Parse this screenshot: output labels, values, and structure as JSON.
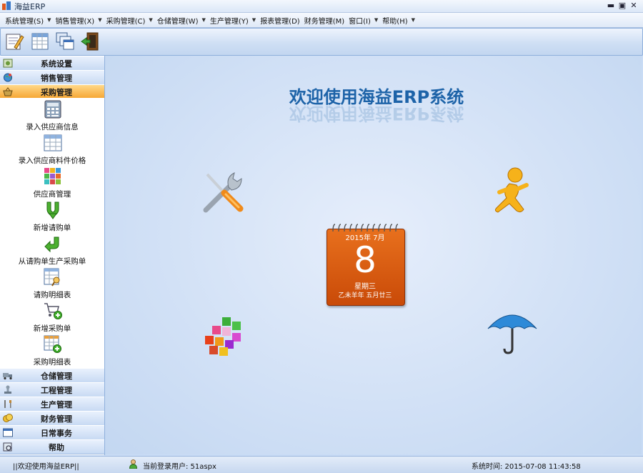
{
  "window": {
    "title": "海益ERP",
    "minimize": "▬",
    "restore": "▣",
    "close": "✕"
  },
  "menu": [
    {
      "label": "系统管理(S)"
    },
    {
      "label": "销售管理(X)"
    },
    {
      "label": "采购管理(C)"
    },
    {
      "label": "仓储管理(W)"
    },
    {
      "label": "生产管理(Y)"
    },
    {
      "label": "报表管理(D)"
    },
    {
      "label": "财务管理(M)"
    },
    {
      "label": "窗口(I)"
    },
    {
      "label": "帮助(H)"
    }
  ],
  "toolbar": {
    "buttons": [
      "notepad-edit-icon",
      "spreadsheet-icon",
      "windows-cascade-icon",
      "exit-door-icon"
    ]
  },
  "sidebar": {
    "top_groups": [
      {
        "label": "系统设置",
        "icon": "settings-icon"
      },
      {
        "label": "销售管理",
        "icon": "globe-icon"
      },
      {
        "label": "采购管理",
        "icon": "basket-icon",
        "active": true
      }
    ],
    "items": [
      {
        "label": "录入供应商信息",
        "icon": "calculator-icon"
      },
      {
        "label": "录入供应商料件价格",
        "icon": "price-grid-icon"
      },
      {
        "label": "供应商管理",
        "icon": "color-blocks-icon"
      },
      {
        "label": "新增请购单",
        "icon": "green-down-arrow-icon"
      },
      {
        "label": "从请购单生产采购单",
        "icon": "green-return-arrow-icon"
      },
      {
        "label": "请购明细表",
        "icon": "table-search-icon"
      },
      {
        "label": "新增采购单",
        "icon": "cart-add-icon"
      },
      {
        "label": "采购明细表",
        "icon": "table-add-icon"
      }
    ],
    "bottom_groups": [
      {
        "label": "仓储管理",
        "icon": "truck-icon"
      },
      {
        "label": "工程管理",
        "icon": "stamp-icon"
      },
      {
        "label": "生产管理",
        "icon": "tools-icon"
      },
      {
        "label": "财务管理",
        "icon": "coins-icon"
      },
      {
        "label": "日常事务",
        "icon": "window-icon"
      },
      {
        "label": "帮助",
        "icon": "help-book-icon"
      }
    ]
  },
  "main": {
    "welcome": "欢迎使用海益ERP系统",
    "calendar": {
      "year_month": "2015年  7月",
      "day": "8",
      "weekday": "星期三",
      "lunar": "乙未羊年  五月廿三"
    }
  },
  "status": {
    "left": "||欢迎使用海益ERP||",
    "user": "当前登录用户: 51aspx",
    "time": "系统时间: 2015-07-08 11:43:58"
  },
  "colors": {
    "accent_orange": "#f6a531",
    "calendar_orange": "#d95a10",
    "title_blue": "#1d63a8",
    "panel_blue": "#c9dcf5"
  }
}
